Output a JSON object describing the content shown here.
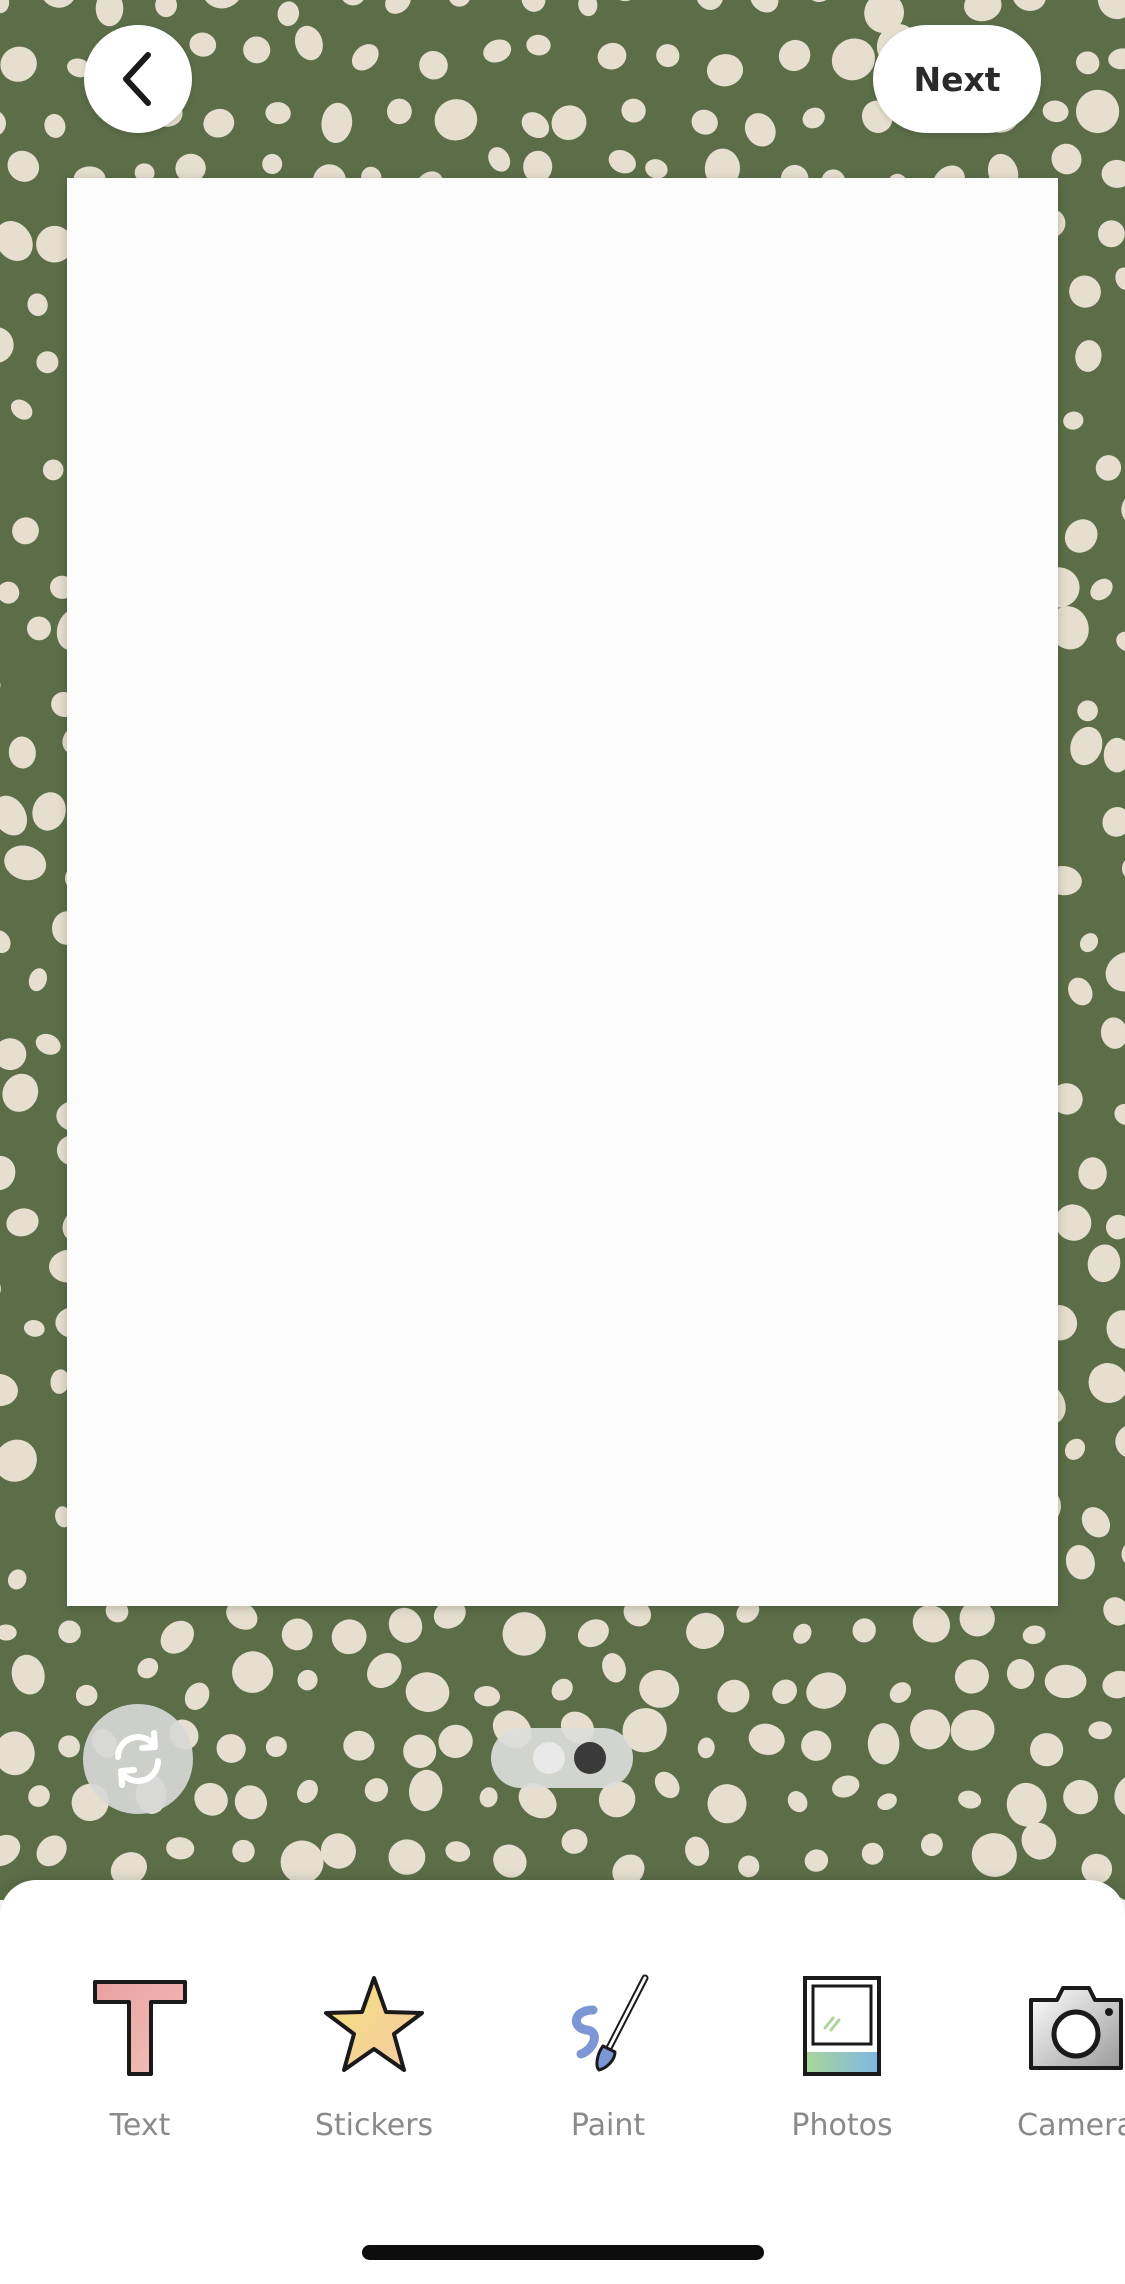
{
  "header": {
    "next_label": "Next"
  },
  "toolbar": {
    "items": [
      {
        "label": "Text",
        "icon": "text-t-icon"
      },
      {
        "label": "Stickers",
        "icon": "star-icon"
      },
      {
        "label": "Paint",
        "icon": "paintbrush-icon"
      },
      {
        "label": "Photos",
        "icon": "photo-frame-icon"
      },
      {
        "label": "Camera",
        "icon": "camera-icon"
      }
    ]
  },
  "colors": {
    "background": "#5c6e48",
    "spots": "#e6dfcf",
    "canvas": "#fcfcfc"
  },
  "page_indicator": {
    "pages": 2,
    "active": 2
  }
}
